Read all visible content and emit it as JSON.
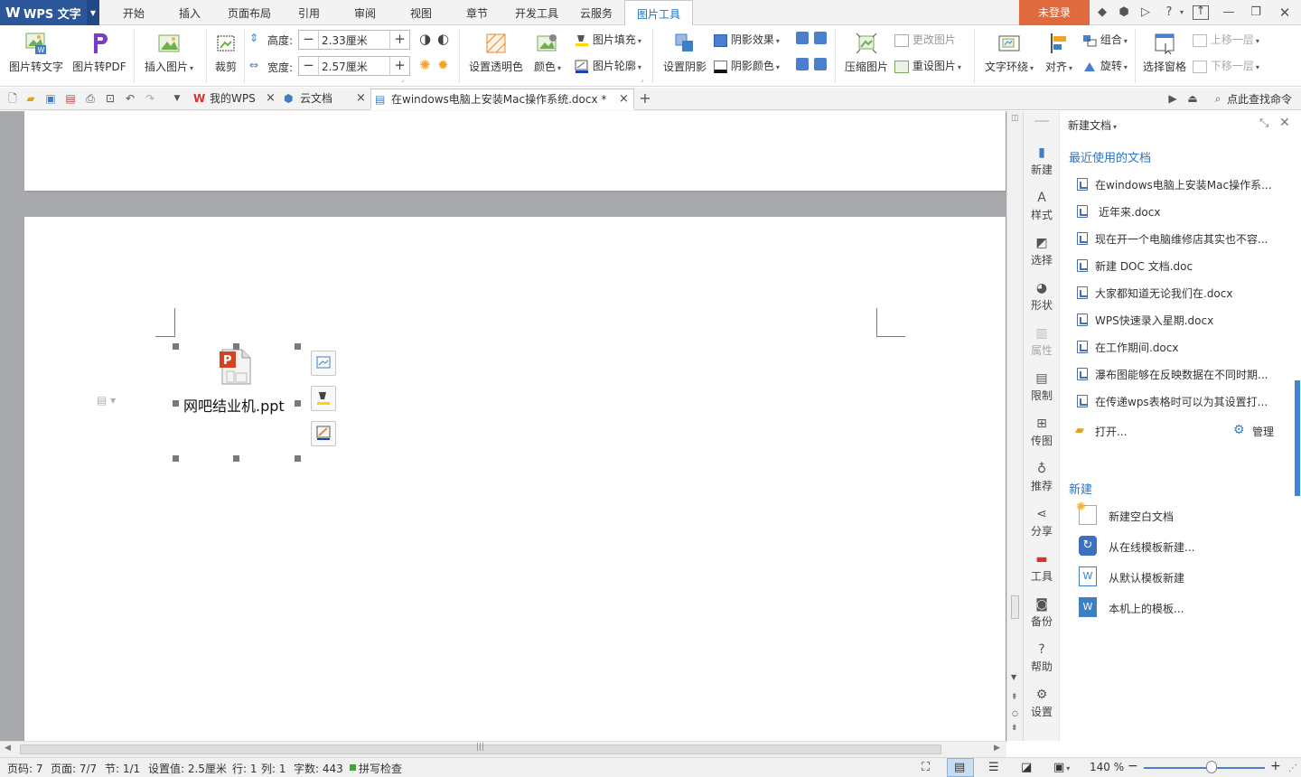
{
  "titlebar": {
    "app_name": "WPS 文字",
    "menu_tabs": [
      "开始",
      "插入",
      "页面布局",
      "引用",
      "审阅",
      "视图",
      "章节",
      "开发工具",
      "云服务",
      "图片工具"
    ],
    "login_label": "未登录"
  },
  "ribbon": {
    "pic_to_text": "图片转文字",
    "pic_to_pdf": "图片转PDF",
    "insert_picture": "插入图片",
    "crop": "裁剪",
    "height_label": "高度:",
    "height_value": "2.33厘米",
    "width_label": "宽度:",
    "width_value": "2.57厘米",
    "set_transparent": "设置透明色",
    "color": "颜色",
    "picture_fill": "图片填充",
    "picture_outline": "图片轮廓",
    "set_shadow": "设置阴影",
    "shadow_effect": "阴影效果",
    "shadow_color": "阴影颜色",
    "compress_picture": "压缩图片",
    "change_picture": "更改图片",
    "reset_picture": "重设图片",
    "text_wrap": "文字环绕",
    "align": "对齐",
    "group": "组合",
    "rotate": "旋转",
    "selection_pane": "选择窗格",
    "bring_forward": "上移一层",
    "send_backward": "下移一层"
  },
  "tabbar": {
    "tabs": [
      "我的WPS",
      "云文档",
      "在windows电脑上安装Mac操作系统.docx *"
    ],
    "search_command": "点此查找命令"
  },
  "document": {
    "object_label": "网吧结业机.ppt"
  },
  "rail": {
    "items": [
      "新建",
      "样式",
      "选择",
      "形状",
      "属性",
      "限制",
      "传图",
      "推荐",
      "分享",
      "工具",
      "备份",
      "帮助",
      "设置"
    ]
  },
  "panel": {
    "title": "新建文档",
    "recent_header": "最近使用的文档",
    "recent_docs": [
      "在windows电脑上安装Mac操作系...",
      "近年来.docx",
      "现在开一个电脑维修店其实也不容...",
      "新建 DOC 文档.doc",
      "大家都知道无论我们在.docx",
      "WPS快速录入星期.docx",
      "在工作期间.docx",
      "瀑布图能够在反映数据在不同时期...",
      "在传递wps表格时可以为其设置打..."
    ],
    "open_label": "打开...",
    "manage_label": "管理",
    "new_header": "新建",
    "new_items": [
      "新建空白文档",
      "从在线模板新建...",
      "从默认模板新建",
      "本机上的模板..."
    ]
  },
  "status": {
    "page_num": "页码: 7",
    "page_count": "页面: 7/7",
    "section": "节: 1/1",
    "setting": "设置值: 2.5厘米",
    "row": "行: 1",
    "col": "列: 1",
    "word_count": "字数: 443",
    "spell_check": "拼写检查",
    "zoom": "140 %",
    "zoom_fraction": 0.56
  },
  "colors": {
    "app_blue": "#2b579a",
    "active_tab": "#1e6fbf",
    "login_orange": "#e06a3e",
    "ppt_red": "#d04423"
  }
}
